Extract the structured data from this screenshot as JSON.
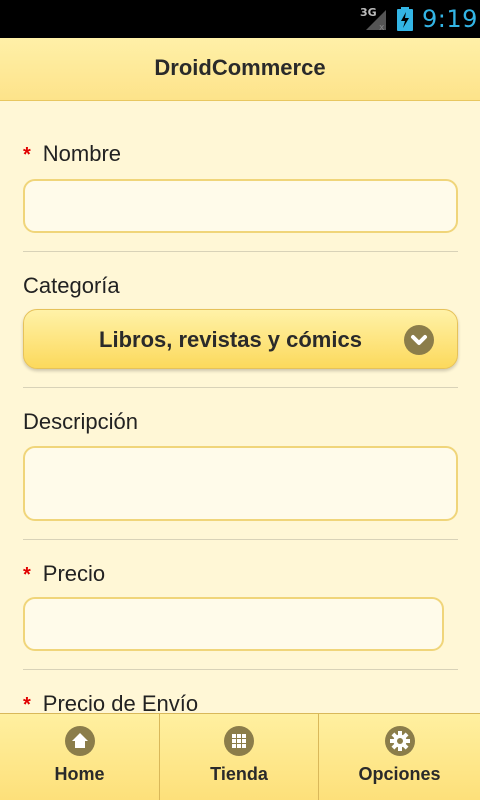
{
  "status": {
    "network": "3G",
    "time": "9:19"
  },
  "header": {
    "title": "DroidCommerce"
  },
  "form": {
    "nombre": {
      "label": "Nombre",
      "required": "*",
      "value": ""
    },
    "categoria": {
      "label": "Categoría",
      "selected": "Libros, revistas y cómics"
    },
    "descripcion": {
      "label": "Descripción",
      "value": ""
    },
    "precio": {
      "label": "Precio",
      "required": "*",
      "value": ""
    },
    "precio_envio": {
      "label": "Precio de Envío",
      "required": "*"
    }
  },
  "tabs": [
    {
      "label": "Home",
      "icon": "home-icon"
    },
    {
      "label": "Tienda",
      "icon": "grid-icon"
    },
    {
      "label": "Opciones",
      "icon": "gear-icon"
    }
  ],
  "colors": {
    "accent_text": "#33b5e5",
    "required": "#e00000",
    "icon_bg": "#8b7d4a"
  }
}
